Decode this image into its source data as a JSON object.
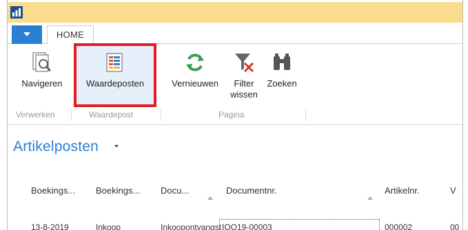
{
  "colors": {
    "titlebar": "#f9dd8c",
    "accent_blue": "#2a7fd3",
    "highlight_border": "#e01d24",
    "highlight_fill": "#e6f0fa",
    "refresh_green": "#3a9c52",
    "filter_red": "#d23a2a"
  },
  "tabs": {
    "home": "HOME"
  },
  "ribbon": {
    "buttons": {
      "navigeren": {
        "label": "Navigeren",
        "icon": "navigate-icon"
      },
      "waardeposten": {
        "label": "Waardeposten",
        "icon": "value-entries-icon"
      },
      "vernieuwen": {
        "label": "Vernieuwen",
        "icon": "refresh-icon"
      },
      "filter_wissen": {
        "label_line1": "Filter",
        "label_line2": "wissen",
        "icon": "clear-filter-icon"
      },
      "zoeken": {
        "label": "Zoeken",
        "icon": "binoculars-icon"
      }
    },
    "groups": {
      "verwerken": "Verwerken",
      "waardepost": "Waardepost",
      "pagina": "Pagina"
    }
  },
  "page": {
    "title": "Artikelposten"
  },
  "grid": {
    "headers": [
      "Boekings...",
      "Boekings...",
      "Docu...",
      "Documentnr.",
      "Artikelnr.",
      "V"
    ],
    "first_row_partial": [
      "13-8-2019",
      "Inkoop",
      "Inkoopontvangst",
      "IOO19-00003",
      "000002",
      "00"
    ]
  }
}
